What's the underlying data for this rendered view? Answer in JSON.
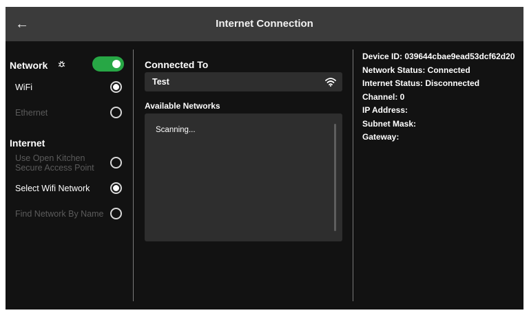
{
  "header": {
    "back_icon": "arrow-left-icon",
    "title": "Internet Connection"
  },
  "network_section": {
    "label": "Network",
    "bug_icon": "bug-icon",
    "toggle_on": true,
    "options": [
      {
        "label": "WiFi",
        "selected": true,
        "enabled": true
      },
      {
        "label": "Ethernet",
        "selected": false,
        "enabled": false
      }
    ]
  },
  "internet_section": {
    "label": "Internet",
    "options": [
      {
        "line1": "Use Open Kitchen",
        "line2": "Secure Access Point",
        "selected": false,
        "enabled": false
      },
      {
        "label": "Select Wifi Network",
        "selected": true,
        "enabled": true
      },
      {
        "label": "Find Network By Name",
        "selected": false,
        "enabled": false
      }
    ]
  },
  "connected": {
    "heading": "Connected To",
    "network": "Test",
    "icon": "wifi-icon"
  },
  "available": {
    "heading": "Available Networks",
    "status": "Scanning..."
  },
  "device_info": {
    "device_id": "Device ID: 039644cbae9ead53dcf62d20",
    "network_status": "Network Status: Connected",
    "internet_status": "Internet Status: Disconnected",
    "channel": "Channel: 0",
    "ip_address": "IP Address:",
    "subnet_mask": "Subnet Mask:",
    "gateway": "Gateway:"
  },
  "colors": {
    "toggle_on": "#27a745",
    "header_bg": "#3b3b3b",
    "panel_bg": "#2e2e2e",
    "screen_bg": "#121212"
  }
}
